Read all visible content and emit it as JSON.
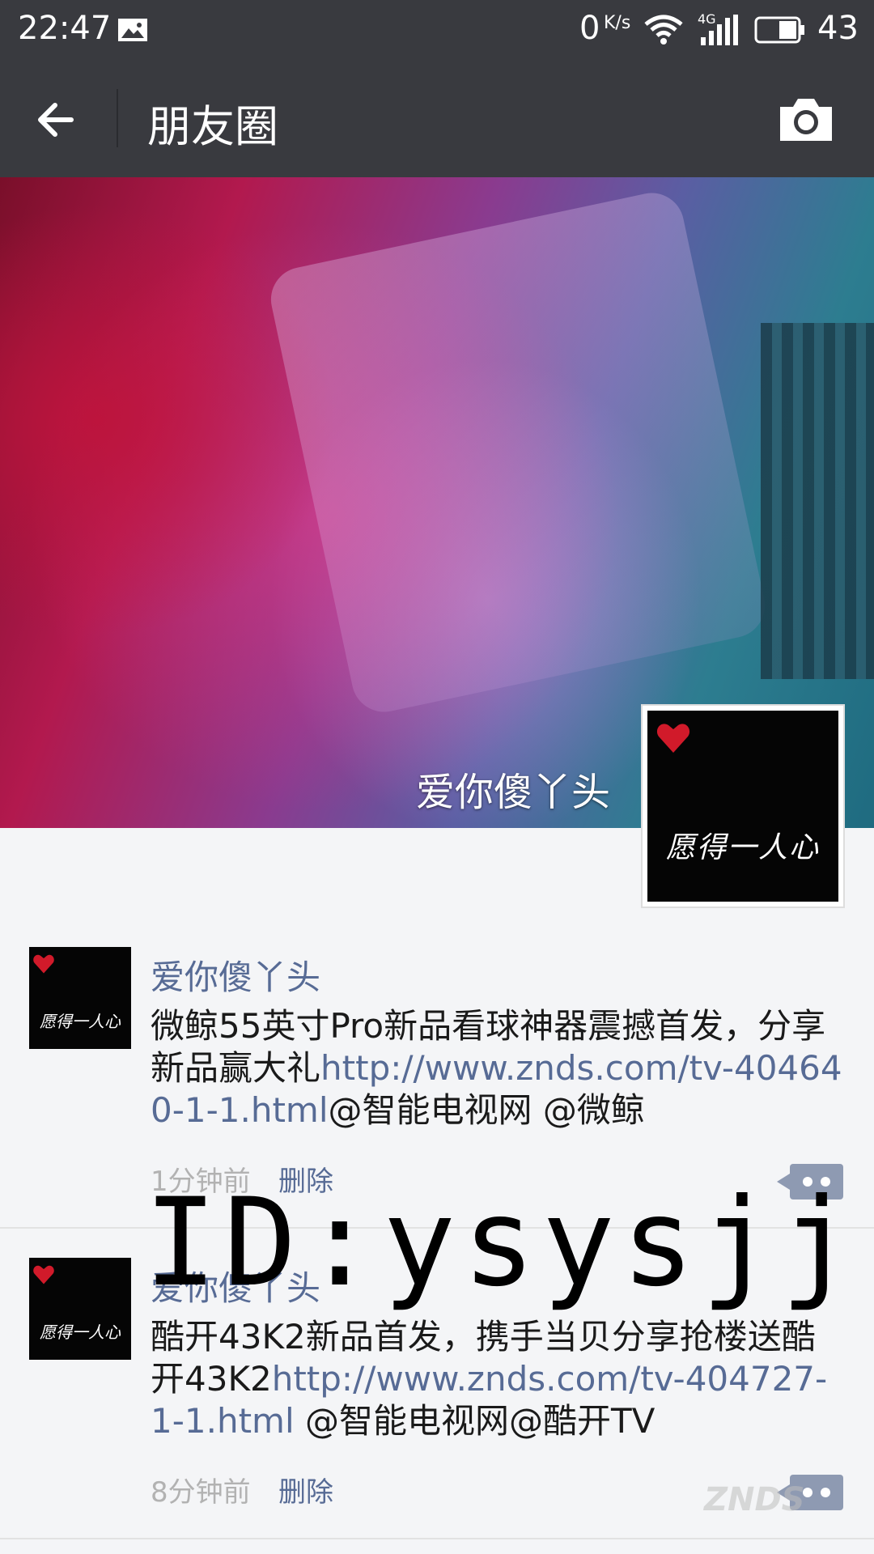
{
  "status_bar": {
    "time": "22:47",
    "speed_value": "0",
    "speed_unit": "K/s",
    "network_type": "4G",
    "battery_percent": "43",
    "icons": [
      "image-icon",
      "wifi-icon",
      "signal-icon",
      "battery-icon"
    ]
  },
  "header": {
    "title": "朋友圈",
    "back_icon": "back-arrow-icon",
    "camera_icon": "camera-icon"
  },
  "cover": {
    "username": "爱你傻丫头",
    "avatar_text": "愿得一人心"
  },
  "posts": [
    {
      "author": "爱你傻丫头",
      "avatar_text": "愿得一人心",
      "text_before": "微鲸55英寸Pro新品看球神器震撼首发，分享新品赢大礼",
      "link": "http://www.znds.com/tv-404640-1-1.html",
      "text_after": "@智能电视网 @微鲸",
      "time": "1分钟前",
      "delete_label": "删除"
    },
    {
      "author": "爱你傻丫头",
      "avatar_text": "愿得一人心",
      "text_before": "酷开43K2新品首发，携手当贝分享抢楼送酷开43K2",
      "link": "http://www.znds.com/tv-404727-1-1.html",
      "text_after": " @智能电视网@酷开TV",
      "time": "8分钟前",
      "delete_label": "删除"
    }
  ],
  "overlay": {
    "watermark": "ID:ysysjj",
    "brand": "ZNDS"
  },
  "colors": {
    "bar_bg": "#393a3f",
    "link": "#576b95",
    "page_bg": "#f4f5f7",
    "meta_gray": "#b2b2b2"
  }
}
